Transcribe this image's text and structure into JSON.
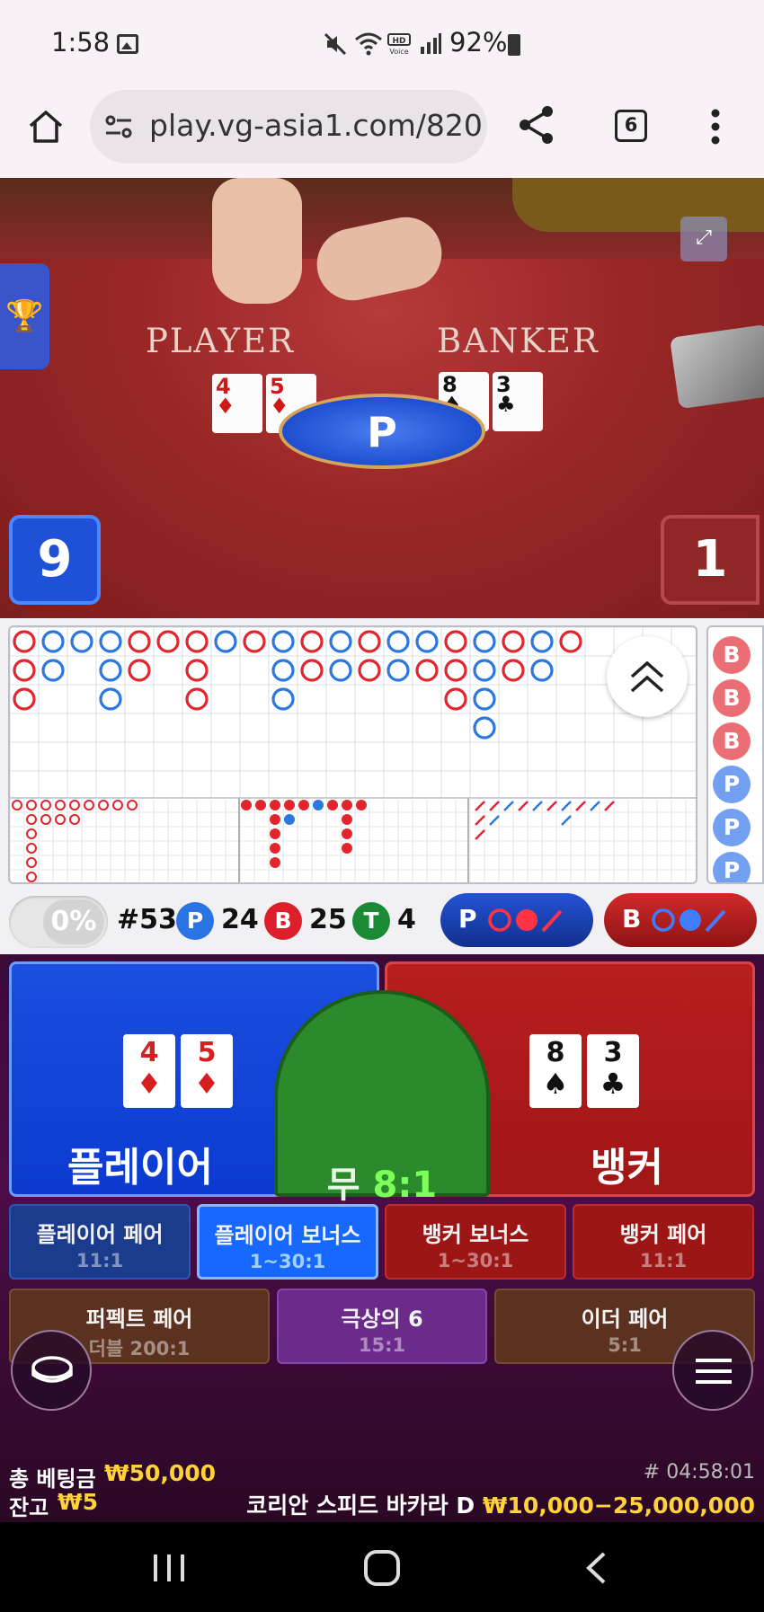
{
  "status_bar": {
    "time": "1:58",
    "battery": "92%"
  },
  "browser": {
    "url": "play.vg-asia1.com/820",
    "tab_count": "6"
  },
  "table_view": {
    "player_label": "PLAYER",
    "banker_label": "BANKER",
    "player_cards": [
      {
        "rank": "4",
        "suit": "♦"
      },
      {
        "rank": "5",
        "suit": "♦"
      }
    ],
    "banker_cards": [
      {
        "rank": "8",
        "suit": "♠"
      },
      {
        "rank": "3",
        "suit": "♣"
      }
    ],
    "winner_badge": "P",
    "player_score": "9",
    "banker_score": "1"
  },
  "stats": {
    "percent": "0%",
    "shoe_round": "#53",
    "player_letter": "P",
    "player_count": "24",
    "banker_letter": "B",
    "banker_count": "25",
    "tie_letter": "T",
    "tie_count": "4",
    "ask_player": "P",
    "ask_banker": "B"
  },
  "side_road": [
    "B",
    "B",
    "B",
    "P",
    "P",
    "P"
  ],
  "bets": {
    "player": "플레이어",
    "tie": "무",
    "tie_odds": "8:1",
    "banker": "뱅커",
    "side": [
      {
        "name": "플레이어 페어",
        "odds": "11:1"
      },
      {
        "name": "플레이어 보너스",
        "odds": "1~30:1"
      },
      {
        "name": "뱅커 보너스",
        "odds": "1~30:1"
      },
      {
        "name": "뱅커 페어",
        "odds": "11:1"
      },
      {
        "name": "퍼펙트 페어",
        "odds": "더블 200:1"
      },
      {
        "name": "극상의 6",
        "odds": "15:1"
      },
      {
        "name": "이더 페어",
        "odds": "5:1"
      }
    ]
  },
  "footer": {
    "total_bet_label": "총 베팅금",
    "total_bet_value": "₩50,000",
    "balance_label": "잔고",
    "balance_value": "₩5",
    "round_id": "# 04:58:01",
    "table_name": "코리안 스피드 바카라 D",
    "table_limit": "₩10,000−25,000,000"
  },
  "colors": {
    "player_blue": "#1a4fe0",
    "banker_red": "#b81e1e",
    "tie_green": "#2b8a2b",
    "gold": "#ffd23a"
  }
}
